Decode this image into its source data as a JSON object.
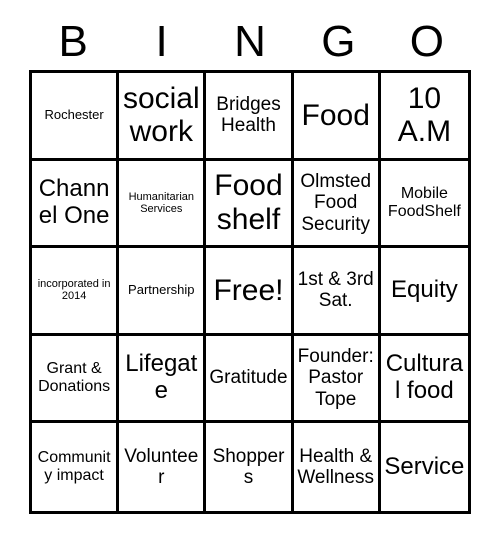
{
  "card": {
    "header_letters": [
      "B",
      "I",
      "N",
      "G",
      "O"
    ],
    "border_color": "#000000",
    "background_color": "#ffffff",
    "text_color": "#000000",
    "rows": 5,
    "columns": 5,
    "cells": [
      {
        "text": "Rochester",
        "size": "sm"
      },
      {
        "text": "social work",
        "size": "xxl"
      },
      {
        "text": "Bridges Health",
        "size": "lg"
      },
      {
        "text": "Food",
        "size": "xxl"
      },
      {
        "text": "10 A.M",
        "size": "xxl"
      },
      {
        "text": "Channel One",
        "size": "xl"
      },
      {
        "text": "Humanitarian Services",
        "size": "xs"
      },
      {
        "text": "Food shelf",
        "size": "xxl"
      },
      {
        "text": "Olmsted Food Security",
        "size": "lg"
      },
      {
        "text": "Mobile FoodShelf",
        "size": "md"
      },
      {
        "text": "incorporated in 2014",
        "size": "xs"
      },
      {
        "text": "Partnership",
        "size": "sm"
      },
      {
        "text": "Free!",
        "size": "xxl"
      },
      {
        "text": "1st & 3rd Sat.",
        "size": "lg"
      },
      {
        "text": "Equity",
        "size": "xl"
      },
      {
        "text": "Grant & Donations",
        "size": "md"
      },
      {
        "text": "Lifegate",
        "size": "xl"
      },
      {
        "text": "Gratitude",
        "size": "lg"
      },
      {
        "text": "Founder: Pastor Tope",
        "size": "lg"
      },
      {
        "text": "Cultural food",
        "size": "xl"
      },
      {
        "text": "Community impact",
        "size": "md"
      },
      {
        "text": "Volunteer",
        "size": "lg"
      },
      {
        "text": "Shoppers",
        "size": "lg"
      },
      {
        "text": "Health & Wellness",
        "size": "lg"
      },
      {
        "text": "Service",
        "size": "xl"
      }
    ]
  }
}
